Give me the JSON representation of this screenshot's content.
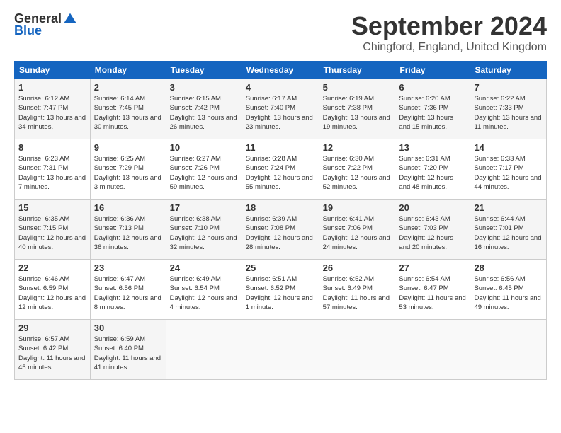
{
  "logo": {
    "general": "General",
    "blue": "Blue"
  },
  "header": {
    "month": "September 2024",
    "location": "Chingford, England, United Kingdom"
  },
  "days_header": [
    "Sunday",
    "Monday",
    "Tuesday",
    "Wednesday",
    "Thursday",
    "Friday",
    "Saturday"
  ],
  "weeks": [
    [
      {
        "day": "1",
        "sunrise": "6:12 AM",
        "sunset": "7:47 PM",
        "daylight": "13 hours and 34 minutes."
      },
      {
        "day": "2",
        "sunrise": "6:14 AM",
        "sunset": "7:45 PM",
        "daylight": "13 hours and 30 minutes."
      },
      {
        "day": "3",
        "sunrise": "6:15 AM",
        "sunset": "7:42 PM",
        "daylight": "13 hours and 26 minutes."
      },
      {
        "day": "4",
        "sunrise": "6:17 AM",
        "sunset": "7:40 PM",
        "daylight": "13 hours and 23 minutes."
      },
      {
        "day": "5",
        "sunrise": "6:19 AM",
        "sunset": "7:38 PM",
        "daylight": "13 hours and 19 minutes."
      },
      {
        "day": "6",
        "sunrise": "6:20 AM",
        "sunset": "7:36 PM",
        "daylight": "13 hours and 15 minutes."
      },
      {
        "day": "7",
        "sunrise": "6:22 AM",
        "sunset": "7:33 PM",
        "daylight": "13 hours and 11 minutes."
      }
    ],
    [
      {
        "day": "8",
        "sunrise": "6:23 AM",
        "sunset": "7:31 PM",
        "daylight": "13 hours and 7 minutes."
      },
      {
        "day": "9",
        "sunrise": "6:25 AM",
        "sunset": "7:29 PM",
        "daylight": "13 hours and 3 minutes."
      },
      {
        "day": "10",
        "sunrise": "6:27 AM",
        "sunset": "7:26 PM",
        "daylight": "12 hours and 59 minutes."
      },
      {
        "day": "11",
        "sunrise": "6:28 AM",
        "sunset": "7:24 PM",
        "daylight": "12 hours and 55 minutes."
      },
      {
        "day": "12",
        "sunrise": "6:30 AM",
        "sunset": "7:22 PM",
        "daylight": "12 hours and 52 minutes."
      },
      {
        "day": "13",
        "sunrise": "6:31 AM",
        "sunset": "7:20 PM",
        "daylight": "12 hours and 48 minutes."
      },
      {
        "day": "14",
        "sunrise": "6:33 AM",
        "sunset": "7:17 PM",
        "daylight": "12 hours and 44 minutes."
      }
    ],
    [
      {
        "day": "15",
        "sunrise": "6:35 AM",
        "sunset": "7:15 PM",
        "daylight": "12 hours and 40 minutes."
      },
      {
        "day": "16",
        "sunrise": "6:36 AM",
        "sunset": "7:13 PM",
        "daylight": "12 hours and 36 minutes."
      },
      {
        "day": "17",
        "sunrise": "6:38 AM",
        "sunset": "7:10 PM",
        "daylight": "12 hours and 32 minutes."
      },
      {
        "day": "18",
        "sunrise": "6:39 AM",
        "sunset": "7:08 PM",
        "daylight": "12 hours and 28 minutes."
      },
      {
        "day": "19",
        "sunrise": "6:41 AM",
        "sunset": "7:06 PM",
        "daylight": "12 hours and 24 minutes."
      },
      {
        "day": "20",
        "sunrise": "6:43 AM",
        "sunset": "7:03 PM",
        "daylight": "12 hours and 20 minutes."
      },
      {
        "day": "21",
        "sunrise": "6:44 AM",
        "sunset": "7:01 PM",
        "daylight": "12 hours and 16 minutes."
      }
    ],
    [
      {
        "day": "22",
        "sunrise": "6:46 AM",
        "sunset": "6:59 PM",
        "daylight": "12 hours and 12 minutes."
      },
      {
        "day": "23",
        "sunrise": "6:47 AM",
        "sunset": "6:56 PM",
        "daylight": "12 hours and 8 minutes."
      },
      {
        "day": "24",
        "sunrise": "6:49 AM",
        "sunset": "6:54 PM",
        "daylight": "12 hours and 4 minutes."
      },
      {
        "day": "25",
        "sunrise": "6:51 AM",
        "sunset": "6:52 PM",
        "daylight": "12 hours and 1 minute."
      },
      {
        "day": "26",
        "sunrise": "6:52 AM",
        "sunset": "6:49 PM",
        "daylight": "11 hours and 57 minutes."
      },
      {
        "day": "27",
        "sunrise": "6:54 AM",
        "sunset": "6:47 PM",
        "daylight": "11 hours and 53 minutes."
      },
      {
        "day": "28",
        "sunrise": "6:56 AM",
        "sunset": "6:45 PM",
        "daylight": "11 hours and 49 minutes."
      }
    ],
    [
      {
        "day": "29",
        "sunrise": "6:57 AM",
        "sunset": "6:42 PM",
        "daylight": "11 hours and 45 minutes."
      },
      {
        "day": "30",
        "sunrise": "6:59 AM",
        "sunset": "6:40 PM",
        "daylight": "11 hours and 41 minutes."
      },
      null,
      null,
      null,
      null,
      null
    ]
  ]
}
